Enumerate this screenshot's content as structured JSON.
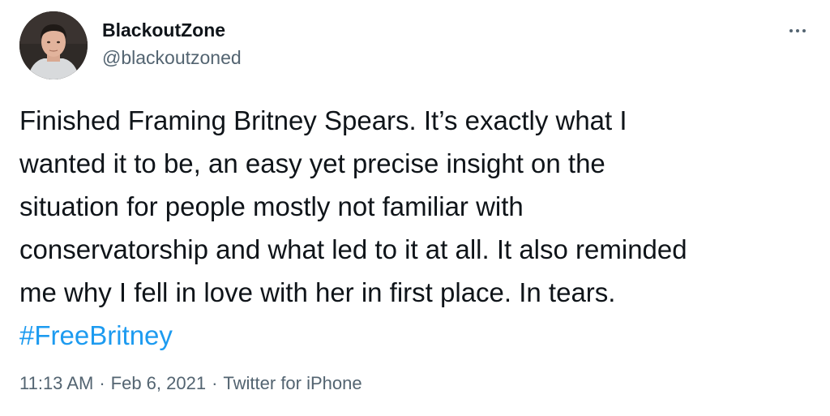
{
  "user": {
    "display_name": "BlackoutZone",
    "handle": "@blackoutzoned",
    "avatar_icon": "profile-photo"
  },
  "menu": {
    "more_icon": "more-horizontal-icon"
  },
  "tweet": {
    "lines": [
      "Finished Framing Britney Spears. It’s exactly what I",
      "wanted it to be, an easy yet precise insight on the",
      "situation for people mostly not familiar with",
      "conservatorship and what led to it at all. It also reminded",
      "me why I fell in love with her in first place. In tears."
    ],
    "hashtag": "#FreeBritney"
  },
  "meta": {
    "time": "11:13 AM",
    "separator": "·",
    "date": "Feb 6, 2021",
    "source": "Twitter for iPhone"
  },
  "colors": {
    "text": "#0f1419",
    "secondary": "#536471",
    "link": "#1d9bf0"
  }
}
